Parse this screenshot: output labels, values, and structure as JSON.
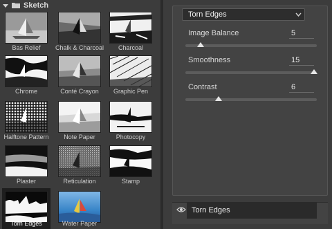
{
  "gallery": {
    "category": "Sketch",
    "filters": [
      {
        "label": "Bas Relief"
      },
      {
        "label": "Chalk & Charcoal"
      },
      {
        "label": "Charcoal"
      },
      {
        "label": "Chrome"
      },
      {
        "label": "Conté Crayon"
      },
      {
        "label": "Graphic Pen"
      },
      {
        "label": "Halftone Pattern"
      },
      {
        "label": "Note Paper"
      },
      {
        "label": "Photocopy"
      },
      {
        "label": "Plaster"
      },
      {
        "label": "Reticulation"
      },
      {
        "label": "Stamp"
      },
      {
        "label": "Torn Edges",
        "selected": true
      },
      {
        "label": "Water Paper"
      }
    ]
  },
  "settings": {
    "filter_name": "Torn Edges",
    "params": [
      {
        "label": "Image Balance",
        "value": "5",
        "level": 0.1
      },
      {
        "label": "Smoothness",
        "value": "15",
        "level": 1.0
      },
      {
        "label": "Contrast",
        "value": "6",
        "level": 0.24
      }
    ]
  },
  "layers": {
    "effect_name": "Torn Edges"
  }
}
